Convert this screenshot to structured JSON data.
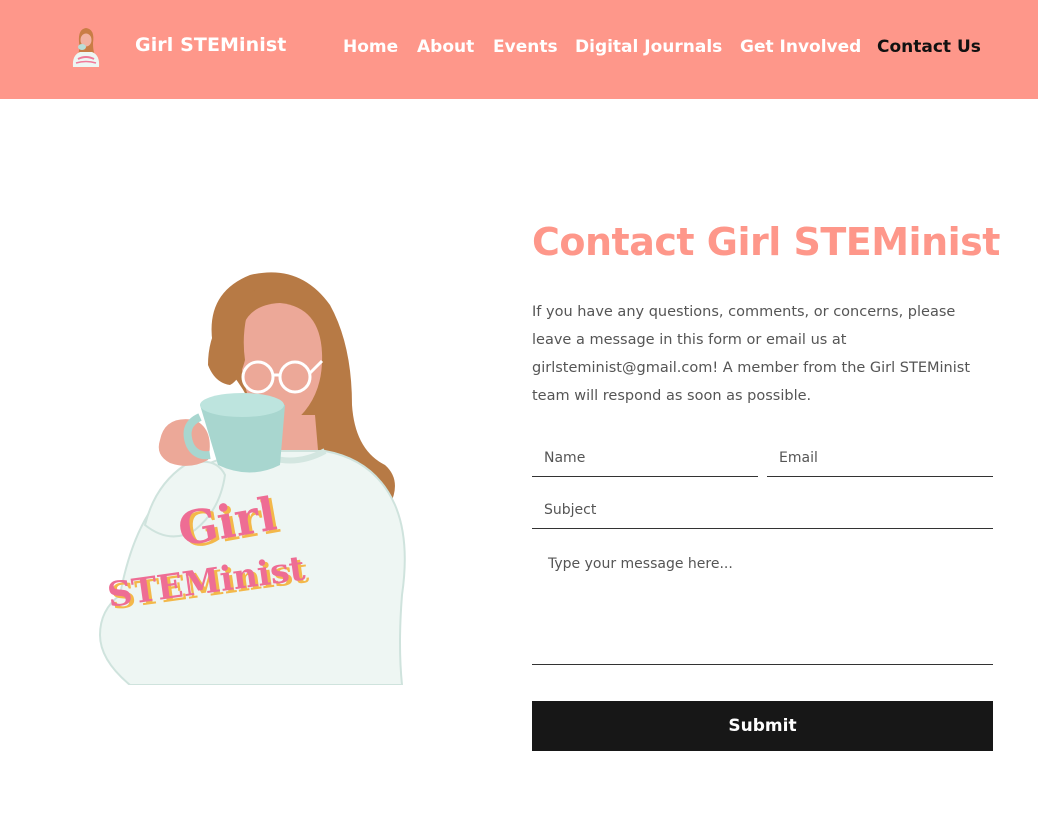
{
  "header": {
    "site_title": "Girl STEMinist",
    "nav": [
      {
        "label": "Home"
      },
      {
        "label": "About"
      },
      {
        "label": "Events"
      },
      {
        "label": "Digital Journals"
      },
      {
        "label": "Get Involved"
      },
      {
        "label": "Contact Us",
        "active": true
      }
    ]
  },
  "contact": {
    "heading": "Contact Girl STEMinist",
    "intro": "If you have any questions, comments, or concerns, please leave a message in this form or email us at girlsteminist@gmail.com! A member from the Girl STEMinist team will respond as soon as possible.",
    "form": {
      "name_placeholder": "Name",
      "email_placeholder": "Email",
      "subject_placeholder": "Subject",
      "message_placeholder": "Type your message here...",
      "submit_label": "Submit"
    }
  },
  "illustration": {
    "sweater_word_1": "Girl",
    "sweater_word_2": "STEMinist"
  },
  "colors": {
    "brand": "#fe978a",
    "button": "#171717",
    "active_nav": "#111111"
  }
}
